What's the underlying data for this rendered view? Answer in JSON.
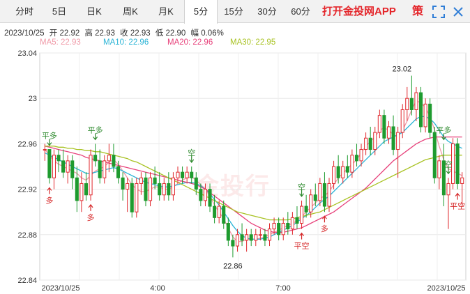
{
  "tabs": [
    {
      "label": "分时",
      "active": false
    },
    {
      "label": "5日",
      "active": false
    },
    {
      "label": "日K",
      "active": false
    },
    {
      "label": "周K",
      "active": false
    },
    {
      "label": "月K",
      "active": false
    },
    {
      "label": "5分",
      "active": true
    },
    {
      "label": "15分",
      "active": false
    },
    {
      "label": "30分",
      "active": false
    },
    {
      "label": "60分",
      "active": false
    }
  ],
  "brand": "打开金投网APP",
  "controls": {
    "strategy_label": "策",
    "fullscreen_icon": "fullscreen-icon",
    "close_icon": "close-icon"
  },
  "info_bar": {
    "date": "2023/10/25",
    "open": "开 22.92",
    "high": "高 22.93",
    "close": "收 22.93",
    "low": "低 22.90",
    "amp": "幅 0.06%"
  },
  "ma_legend": [
    {
      "label": "MA5: 22.93",
      "color": "#f09aa8"
    },
    {
      "label": "MA10: 22.96",
      "color": "#2bb4d6"
    },
    {
      "label": "MA20: 22.96",
      "color": "#e7407a"
    },
    {
      "label": "MA30: 22.95",
      "color": "#a8c222"
    }
  ],
  "watermark": "金投行",
  "chart_data": {
    "type": "candlestick",
    "y_ticks": [
      "23.04",
      "23",
      "22.96",
      "22.92",
      "22.88",
      "22.84"
    ],
    "ylim": [
      22.84,
      23.04
    ],
    "x_ticks": [
      "2023/10/25",
      "4:00",
      "7:00",
      "2023/10/25"
    ],
    "annotations": {
      "max_label": "23.02",
      "min_label": "22.86"
    },
    "signals": [
      {
        "label": "平多",
        "dir": "down",
        "color": "#2e8a2e",
        "index": 1
      },
      {
        "label": "平多",
        "dir": "down",
        "color": "#2e8a2e",
        "index": 11
      },
      {
        "label": "多",
        "dir": "up",
        "color": "#d62728",
        "index": 1
      },
      {
        "label": "多",
        "dir": "up",
        "color": "#d62728",
        "index": 10
      },
      {
        "label": "空",
        "dir": "down",
        "color": "#2e8a2e",
        "index": 32
      },
      {
        "label": "空",
        "dir": "down",
        "color": "#2e8a2e",
        "index": 56
      },
      {
        "label": "平空",
        "dir": "up",
        "color": "#d62728",
        "index": 56
      },
      {
        "label": "多",
        "dir": "up",
        "color": "#d62728",
        "index": 61
      },
      {
        "label": "平多",
        "dir": "down",
        "color": "#2e8a2e",
        "index": 87
      },
      {
        "label": "空",
        "dir": "down",
        "color": "#2e8a2e",
        "index": 88
      },
      {
        "label": "平空",
        "dir": "up",
        "color": "#d62728",
        "index": 90
      }
    ],
    "candles": [
      [
        22.955,
        22.96,
        22.945,
        22.955
      ],
      [
        22.955,
        22.955,
        22.925,
        22.93
      ],
      [
        22.93,
        22.955,
        22.92,
        22.95
      ],
      [
        22.95,
        22.955,
        22.935,
        22.945
      ],
      [
        22.945,
        22.955,
        22.93,
        22.935
      ],
      [
        22.935,
        22.95,
        22.925,
        22.945
      ],
      [
        22.945,
        22.95,
        22.92,
        22.93
      ],
      [
        22.93,
        22.94,
        22.9,
        22.91
      ],
      [
        22.91,
        22.935,
        22.9,
        22.925
      ],
      [
        22.925,
        22.935,
        22.91,
        22.915
      ],
      [
        22.915,
        22.955,
        22.91,
        22.95
      ],
      [
        22.95,
        22.96,
        22.94,
        22.945
      ],
      [
        22.945,
        22.955,
        22.925,
        22.93
      ],
      [
        22.93,
        22.95,
        22.925,
        22.945
      ],
      [
        22.945,
        22.96,
        22.935,
        22.95
      ],
      [
        22.95,
        22.96,
        22.935,
        22.94
      ],
      [
        22.94,
        22.945,
        22.925,
        22.93
      ],
      [
        22.93,
        22.935,
        22.91,
        22.92
      ],
      [
        22.92,
        22.93,
        22.9,
        22.925
      ],
      [
        22.925,
        22.93,
        22.895,
        22.9
      ],
      [
        22.9,
        22.93,
        22.895,
        22.925
      ],
      [
        22.925,
        22.935,
        22.915,
        22.93
      ],
      [
        22.93,
        22.935,
        22.905,
        22.91
      ],
      [
        22.91,
        22.935,
        22.905,
        22.93
      ],
      [
        22.93,
        22.94,
        22.92,
        22.925
      ],
      [
        22.925,
        22.935,
        22.91,
        22.915
      ],
      [
        22.915,
        22.93,
        22.91,
        22.925
      ],
      [
        22.925,
        22.935,
        22.91,
        22.915
      ],
      [
        22.915,
        22.935,
        22.91,
        22.93
      ],
      [
        22.93,
        22.94,
        22.925,
        22.935
      ],
      [
        22.935,
        22.94,
        22.925,
        22.93
      ],
      [
        22.93,
        22.94,
        22.925,
        22.935
      ],
      [
        22.935,
        22.94,
        22.925,
        22.93
      ],
      [
        22.93,
        22.935,
        22.915,
        22.92
      ],
      [
        22.92,
        22.925,
        22.905,
        22.91
      ],
      [
        22.91,
        22.925,
        22.905,
        22.92
      ],
      [
        22.92,
        22.925,
        22.9,
        22.905
      ],
      [
        22.905,
        22.915,
        22.89,
        22.895
      ],
      [
        22.895,
        22.91,
        22.89,
        22.905
      ],
      [
        22.905,
        22.91,
        22.885,
        22.89
      ],
      [
        22.89,
        22.895,
        22.87,
        22.875
      ],
      [
        22.875,
        22.88,
        22.86,
        22.87
      ],
      [
        22.87,
        22.885,
        22.865,
        22.88
      ],
      [
        22.88,
        22.89,
        22.87,
        22.875
      ],
      [
        22.875,
        22.885,
        22.865,
        22.88
      ],
      [
        22.88,
        22.885,
        22.87,
        22.875
      ],
      [
        22.875,
        22.885,
        22.87,
        22.88
      ],
      [
        22.88,
        22.885,
        22.875,
        22.88
      ],
      [
        22.88,
        22.885,
        22.87,
        22.875
      ],
      [
        22.875,
        22.89,
        22.87,
        22.885
      ],
      [
        22.885,
        22.895,
        22.88,
        22.89
      ],
      [
        22.89,
        22.895,
        22.875,
        22.88
      ],
      [
        22.88,
        22.895,
        22.875,
        22.89
      ],
      [
        22.89,
        22.9,
        22.88,
        22.885
      ],
      [
        22.885,
        22.9,
        22.88,
        22.895
      ],
      [
        22.895,
        22.905,
        22.885,
        22.89
      ],
      [
        22.89,
        22.91,
        22.885,
        22.905
      ],
      [
        22.905,
        22.915,
        22.895,
        22.9
      ],
      [
        22.9,
        22.92,
        22.895,
        22.915
      ],
      [
        22.915,
        22.925,
        22.905,
        22.91
      ],
      [
        22.91,
        22.93,
        22.905,
        22.925
      ],
      [
        22.925,
        22.935,
        22.9,
        22.905
      ],
      [
        22.905,
        22.93,
        22.9,
        22.925
      ],
      [
        22.925,
        22.945,
        22.92,
        22.94
      ],
      [
        22.94,
        22.95,
        22.925,
        22.93
      ],
      [
        22.93,
        22.945,
        22.925,
        22.94
      ],
      [
        22.94,
        22.95,
        22.93,
        22.935
      ],
      [
        22.935,
        22.955,
        22.93,
        22.95
      ],
      [
        22.95,
        22.96,
        22.94,
        22.945
      ],
      [
        22.945,
        22.96,
        22.94,
        22.955
      ],
      [
        22.955,
        22.97,
        22.95,
        22.965
      ],
      [
        22.965,
        22.975,
        22.95,
        22.955
      ],
      [
        22.955,
        22.975,
        22.95,
        22.97
      ],
      [
        22.97,
        22.99,
        22.965,
        22.985
      ],
      [
        22.985,
        22.99,
        22.96,
        22.965
      ],
      [
        22.965,
        22.98,
        22.96,
        22.975
      ],
      [
        22.975,
        22.985,
        22.95,
        22.955
      ],
      [
        22.955,
        22.975,
        22.93,
        22.97
      ],
      [
        22.97,
        22.995,
        22.965,
        22.99
      ],
      [
        22.99,
        23.01,
        22.98,
        23.0
      ],
      [
        23.0,
        23.02,
        22.985,
        22.99
      ],
      [
        22.99,
        23.01,
        22.98,
        23.005
      ],
      [
        23.005,
        23.01,
        22.97,
        22.975
      ],
      [
        22.975,
        23.0,
        22.97,
        22.995
      ],
      [
        22.995,
        23.0,
        22.965,
        22.97
      ],
      [
        22.97,
        22.975,
        22.925,
        22.93
      ],
      [
        22.93,
        22.95,
        22.92,
        22.945
      ],
      [
        22.945,
        22.96,
        22.905,
        22.915
      ],
      [
        22.915,
        22.93,
        22.885,
        22.925
      ],
      [
        22.925,
        22.965,
        22.92,
        22.96
      ],
      [
        22.96,
        22.965,
        22.92,
        22.925
      ],
      [
        22.925,
        22.935,
        22.905,
        22.93
      ]
    ],
    "ma_lines": {
      "ma5": [
        22.955,
        22.95,
        22.945,
        22.942,
        22.94,
        22.938,
        22.936,
        22.934,
        22.93,
        22.928,
        22.932,
        22.936,
        22.938,
        22.94,
        22.944,
        22.946,
        22.942,
        22.936,
        22.93,
        22.924,
        22.92,
        22.918,
        22.918,
        22.92,
        22.922,
        22.922,
        22.92,
        22.92,
        22.922,
        22.925,
        22.928,
        22.93,
        22.931,
        22.928,
        22.924,
        22.92,
        22.914,
        22.906,
        22.9,
        22.894,
        22.886,
        22.878,
        22.874,
        22.874,
        22.876,
        22.876,
        22.876,
        22.877,
        22.878,
        22.88,
        22.882,
        22.884,
        22.886,
        22.888,
        22.89,
        22.892,
        22.896,
        22.9,
        22.904,
        22.908,
        22.912,
        22.914,
        22.918,
        22.924,
        22.93,
        22.934,
        22.938,
        22.942,
        22.946,
        22.952,
        22.958,
        22.962,
        22.966,
        22.972,
        22.974,
        22.972,
        22.968,
        22.966,
        22.972,
        22.98,
        22.99,
        22.998,
        22.996,
        22.992,
        22.984,
        22.972,
        22.958,
        22.946,
        22.938,
        22.936,
        22.934,
        22.932
      ],
      "ma10": [
        22.952,
        22.95,
        22.948,
        22.946,
        22.944,
        22.942,
        22.94,
        22.938,
        22.936,
        22.934,
        22.934,
        22.935,
        22.936,
        22.937,
        22.938,
        22.939,
        22.938,
        22.936,
        22.934,
        22.932,
        22.93,
        22.928,
        22.926,
        22.925,
        22.924,
        22.923,
        22.922,
        22.922,
        22.923,
        22.924,
        22.925,
        22.926,
        22.926,
        22.925,
        22.923,
        22.92,
        22.916,
        22.911,
        22.906,
        22.9,
        22.894,
        22.888,
        22.883,
        22.879,
        22.877,
        22.876,
        22.876,
        22.876,
        22.877,
        22.878,
        22.88,
        22.882,
        22.884,
        22.886,
        22.888,
        22.891,
        22.894,
        22.897,
        22.9,
        22.904,
        22.908,
        22.911,
        22.914,
        22.918,
        22.922,
        22.926,
        22.93,
        22.934,
        22.938,
        22.942,
        22.946,
        22.95,
        22.954,
        22.958,
        22.962,
        22.964,
        22.966,
        22.968,
        22.97,
        22.974,
        22.978,
        22.982,
        22.984,
        22.984,
        22.982,
        22.978,
        22.972,
        22.966,
        22.962,
        22.96,
        22.958,
        22.956
      ],
      "ma20": [
        22.958,
        22.957,
        22.956,
        22.955,
        22.954,
        22.953,
        22.952,
        22.951,
        22.95,
        22.948,
        22.947,
        22.946,
        22.945,
        22.944,
        22.943,
        22.942,
        22.941,
        22.94,
        22.939,
        22.938,
        22.937,
        22.936,
        22.935,
        22.934,
        22.933,
        22.932,
        22.931,
        22.93,
        22.929,
        22.928,
        22.927,
        22.926,
        22.925,
        22.924,
        22.922,
        22.92,
        22.917,
        22.914,
        22.911,
        22.908,
        22.905,
        22.902,
        22.899,
        22.896,
        22.893,
        22.89,
        22.888,
        22.886,
        22.884,
        22.883,
        22.882,
        22.882,
        22.882,
        22.883,
        22.884,
        22.885,
        22.886,
        22.888,
        22.89,
        22.892,
        22.894,
        22.896,
        22.898,
        22.9,
        22.903,
        22.906,
        22.909,
        22.912,
        22.915,
        22.918,
        22.921,
        22.925,
        22.929,
        22.933,
        22.937,
        22.941,
        22.945,
        22.948,
        22.951,
        22.954,
        22.957,
        22.96,
        22.962,
        22.964,
        22.965,
        22.966,
        22.966,
        22.966,
        22.966,
        22.966,
        22.966,
        22.966
      ],
      "ma30": [
        22.958,
        22.958,
        22.958,
        22.957,
        22.957,
        22.956,
        22.956,
        22.955,
        22.955,
        22.954,
        22.954,
        22.953,
        22.953,
        22.952,
        22.951,
        22.95,
        22.949,
        22.948,
        22.947,
        22.945,
        22.944,
        22.942,
        22.94,
        22.938,
        22.936,
        22.934,
        22.932,
        22.93,
        22.928,
        22.926,
        22.924,
        22.922,
        22.92,
        22.918,
        22.916,
        22.914,
        22.912,
        22.91,
        22.908,
        22.906,
        22.904,
        22.902,
        22.9,
        22.899,
        22.898,
        22.897,
        22.896,
        22.895,
        22.894,
        22.893,
        22.893,
        22.893,
        22.893,
        22.893,
        22.894,
        22.895,
        22.896,
        22.897,
        22.898,
        22.899,
        22.9,
        22.902,
        22.904,
        22.906,
        22.908,
        22.91,
        22.912,
        22.914,
        22.916,
        22.918,
        22.92,
        22.922,
        22.924,
        22.926,
        22.928,
        22.93,
        22.932,
        22.934,
        22.936,
        22.938,
        22.94,
        22.942,
        22.944,
        22.946,
        22.947,
        22.948,
        22.949,
        22.95,
        22.95,
        22.95,
        22.95,
        22.95
      ]
    }
  }
}
